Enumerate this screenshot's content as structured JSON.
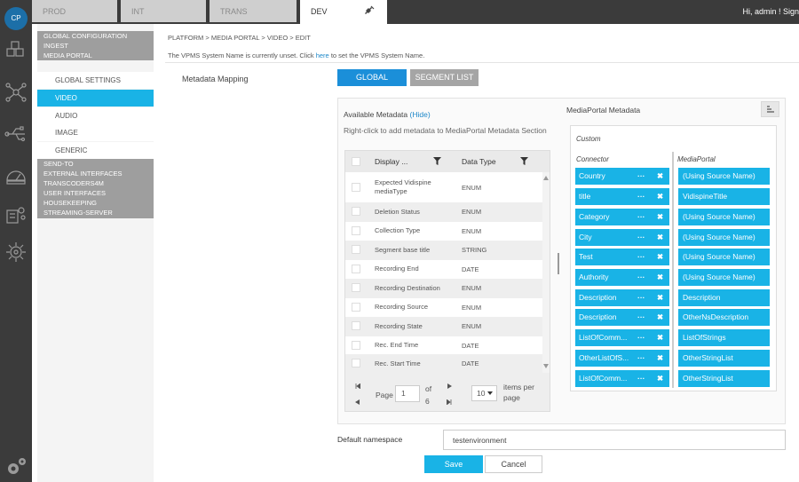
{
  "app": {
    "logo_text": "CP"
  },
  "environments": [
    {
      "label": "PROD",
      "active": false
    },
    {
      "label": "INT",
      "active": false
    },
    {
      "label": "TRANS",
      "active": false
    },
    {
      "label": "DEV",
      "active": true,
      "icon": "plug-icon"
    }
  ],
  "header": {
    "greeting": "Hi, admin !  Sign"
  },
  "rail_icons": [
    "cubes-icon",
    "network-icon",
    "usb-icon",
    "dashboard-icon",
    "transcoder-icon",
    "settings-circle-icon",
    "gears-icon"
  ],
  "sidebar": {
    "top_groups": [
      "GLOBAL CONFIGURATION",
      "INGEST",
      "MEDIA PORTAL"
    ],
    "media_portal_items": [
      {
        "label": "GLOBAL SETTINGS",
        "active": false
      },
      {
        "label": "VIDEO",
        "active": true
      },
      {
        "label": "AUDIO",
        "active": false
      },
      {
        "label": "IMAGE",
        "active": false
      },
      {
        "label": "GENERIC",
        "active": false
      }
    ],
    "bottom_groups": [
      "SEND-TO",
      "EXTERNAL INTERFACES",
      "TRANSCODERS4M",
      "USER INTERFACES",
      "HOUSEKEEPING",
      "STREAMING-SERVER"
    ]
  },
  "breadcrumb": "PLATFORM > MEDIA PORTAL > VIDEO > EDIT",
  "notice": {
    "before": "The VPMS System Name is currently unset. Click ",
    "link": "here",
    "after": " to set the VPMS System Name."
  },
  "mapping": {
    "label": "Metadata Mapping",
    "global_button": "GLOBAL",
    "segment_button": "SEGMENT LIST"
  },
  "available": {
    "title": "Available Metadata",
    "hide_link": "(Hide)",
    "hint": "Right-click to add metadata to MediaPortal Metadata Section",
    "columns": [
      "Display ...",
      "Data Type"
    ],
    "rows": [
      {
        "name": "Expected Vidispine mediaType",
        "type": "ENUM"
      },
      {
        "name": "Deletion Status",
        "type": "ENUM"
      },
      {
        "name": "Collection Type",
        "type": "ENUM"
      },
      {
        "name": "Segment base title",
        "type": "STRING"
      },
      {
        "name": "Recording End",
        "type": "DATE"
      },
      {
        "name": "Recording Destination",
        "type": "ENUM"
      },
      {
        "name": "Recording Source",
        "type": "ENUM"
      },
      {
        "name": "Recording State",
        "type": "ENUM"
      },
      {
        "name": "Rec. End Time",
        "type": "DATE"
      },
      {
        "name": "Rec. Start Time",
        "type": "DATE"
      }
    ],
    "pager": {
      "page_label": "Page",
      "page_value": "1",
      "of_label": "of",
      "total_pages": "6",
      "page_size": "10",
      "items_per_page": "items per page"
    }
  },
  "mediaportal": {
    "title": "MediaPortal Metadata",
    "custom_label": "Custom",
    "connector_header": "Connector",
    "mediaportal_header": "MediaPortal",
    "mappings": [
      {
        "connector": "Country",
        "mediaportal": "(Using Source Name)"
      },
      {
        "connector": "title",
        "mediaportal": "VidispineTitle"
      },
      {
        "connector": "Category",
        "mediaportal": "(Using Source Name)"
      },
      {
        "connector": "City",
        "mediaportal": "(Using Source Name)"
      },
      {
        "connector": "Test",
        "mediaportal": "(Using Source Name)"
      },
      {
        "connector": "Authority",
        "mediaportal": "(Using Source Name)"
      },
      {
        "connector": "Description",
        "mediaportal": "Description"
      },
      {
        "connector": "Description",
        "mediaportal": "OtherNsDescription"
      },
      {
        "connector": "ListOfComm...",
        "mediaportal": "ListOfStrings"
      },
      {
        "connector": "OtherListOfS...",
        "mediaportal": "OtherStringList"
      },
      {
        "connector": "ListOfComm...",
        "mediaportal": "OtherStringList"
      }
    ]
  },
  "namespace": {
    "label": "Default namespace",
    "value": "testenvironment"
  },
  "actions": {
    "save": "Save",
    "cancel": "Cancel"
  },
  "colors": {
    "accent": "#19b3e6",
    "primary_button": "#1b8fd9",
    "rail": "#3b3b3b",
    "nav_group": "#9e9e9e"
  }
}
